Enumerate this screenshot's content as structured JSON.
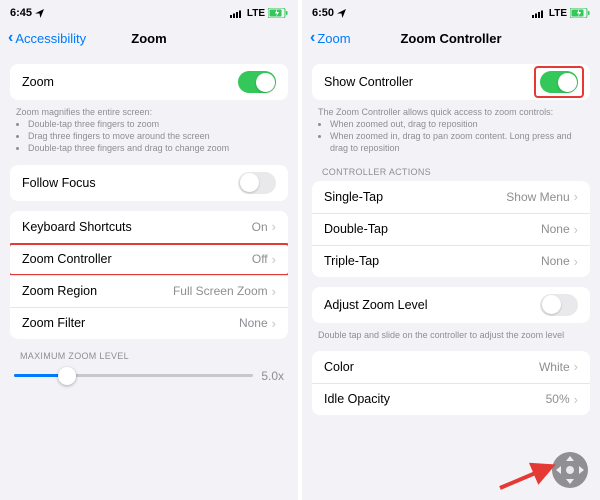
{
  "left": {
    "status": {
      "time": "6:45",
      "network": "LTE"
    },
    "nav": {
      "back": "Accessibility",
      "title": "Zoom"
    },
    "zoom_row": {
      "label": "Zoom"
    },
    "zoom_help": {
      "heading": "Zoom magnifies the entire screen:",
      "b1": "Double-tap three fingers to zoom",
      "b2": "Drag three fingers to move around the screen",
      "b3": "Double-tap three fingers and drag to change zoom"
    },
    "follow_focus": {
      "label": "Follow Focus"
    },
    "rows": {
      "keyboard": {
        "label": "Keyboard Shortcuts",
        "value": "On"
      },
      "controller": {
        "label": "Zoom Controller",
        "value": "Off"
      },
      "region": {
        "label": "Zoom Region",
        "value": "Full Screen Zoom"
      },
      "filter": {
        "label": "Zoom Filter",
        "value": "None"
      }
    },
    "max_header": "MAXIMUM ZOOM LEVEL",
    "slider": {
      "max_label": "5.0x",
      "percent": 22
    }
  },
  "right": {
    "status": {
      "time": "6:50",
      "network": "LTE"
    },
    "nav": {
      "back": "Zoom",
      "title": "Zoom Controller"
    },
    "show_controller": {
      "label": "Show Controller"
    },
    "show_help": {
      "heading": "The Zoom Controller allows quick access to zoom controls:",
      "b1": "When zoomed out, drag to reposition",
      "b2": "When zoomed in, drag to pan zoom content. Long press and drag to reposition"
    },
    "actions_header": "CONTROLLER ACTIONS",
    "actions": {
      "single": {
        "label": "Single-Tap",
        "value": "Show Menu"
      },
      "double": {
        "label": "Double-Tap",
        "value": "None"
      },
      "triple": {
        "label": "Triple-Tap",
        "value": "None"
      }
    },
    "adjust": {
      "label": "Adjust Zoom Level"
    },
    "adjust_help": "Double tap and slide on the controller to adjust the zoom level",
    "appearance": {
      "color": {
        "label": "Color",
        "value": "White"
      },
      "opacity": {
        "label": "Idle Opacity",
        "value": "50%"
      }
    }
  }
}
